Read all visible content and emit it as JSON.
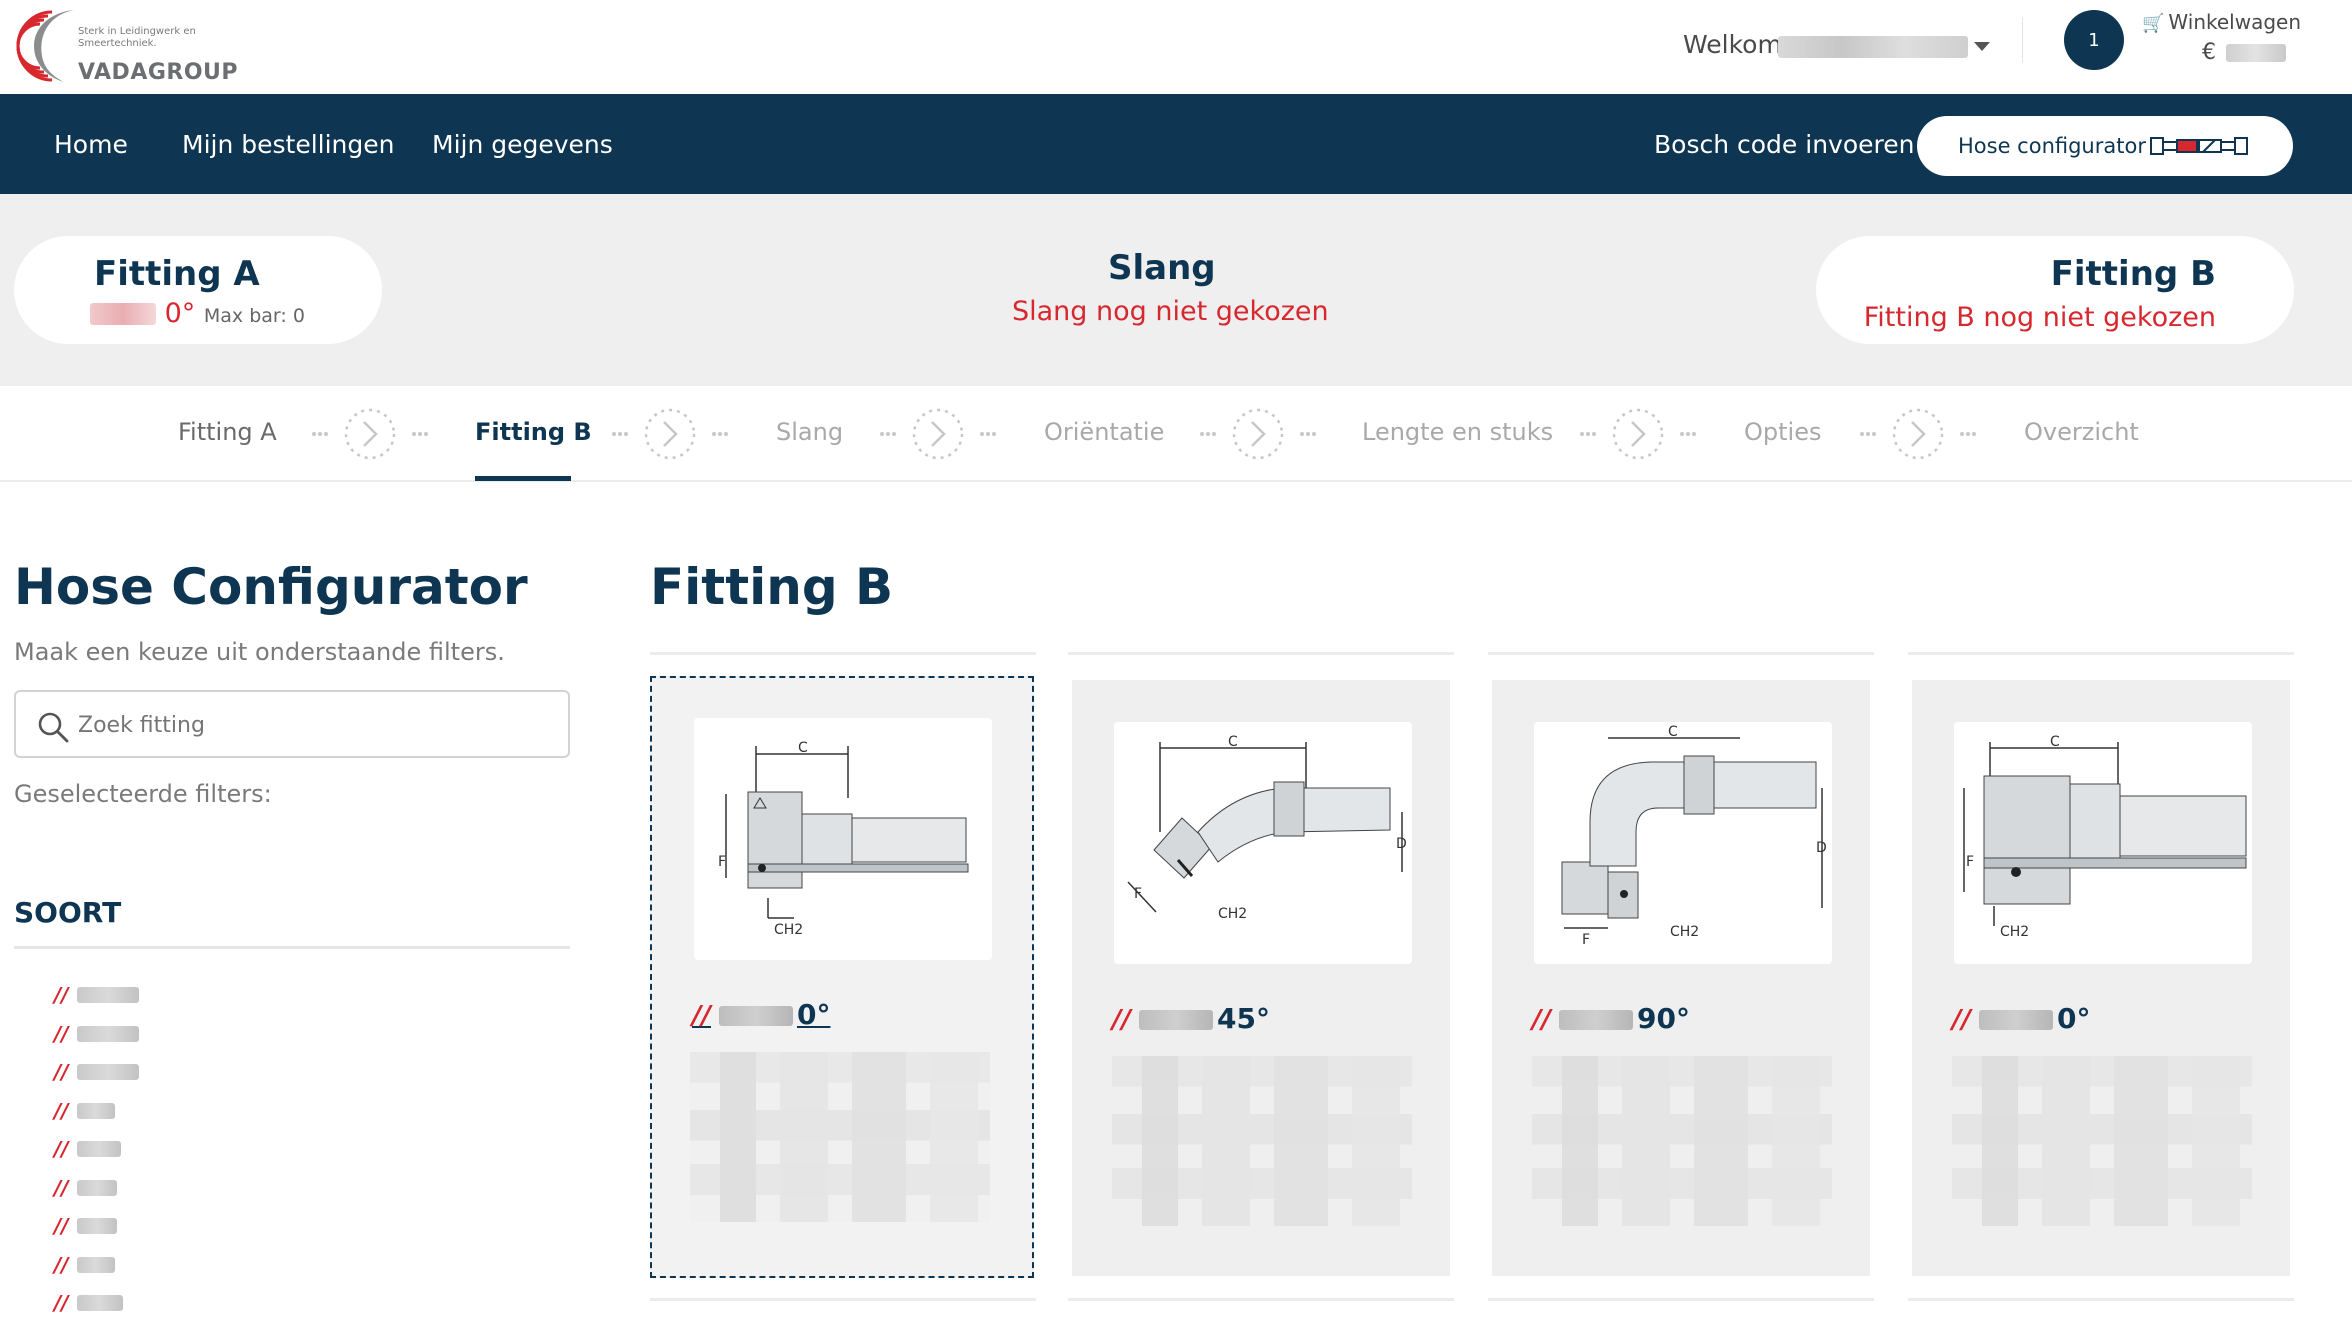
{
  "header": {
    "logo": {
      "tagline": "Sterk in Leidingwerk en Smeertechniek.",
      "name": "VADAGROUP"
    },
    "welcome_label": "Welkom",
    "cart": {
      "badge_count": "1",
      "label": "Winkelwagen",
      "currency": "€"
    }
  },
  "nav": {
    "items": [
      {
        "label": "Home"
      },
      {
        "label": "Mijn bestellingen"
      },
      {
        "label": "Mijn gegevens"
      }
    ],
    "bosch_code": "Bosch code invoeren",
    "hose_configurator": "Hose configurator"
  },
  "summary": {
    "fitting_a": {
      "title": "Fitting A",
      "angle": "0°",
      "maxbar": "Max bar: 0"
    },
    "slang": {
      "title": "Slang",
      "status": "Slang nog niet gekozen"
    },
    "fitting_b": {
      "title": "Fitting B",
      "status": "Fitting B nog niet gekozen"
    }
  },
  "steps": [
    {
      "label": "Fitting A",
      "state": "done"
    },
    {
      "label": "Fitting B",
      "state": "active"
    },
    {
      "label": "Slang",
      "state": "todo"
    },
    {
      "label": "Oriëntatie",
      "state": "todo"
    },
    {
      "label": "Lengte en stuks",
      "state": "todo"
    },
    {
      "label": "Opties",
      "state": "todo"
    },
    {
      "label": "Overzicht",
      "state": "todo"
    }
  ],
  "sidebar": {
    "title": "Hose Configurator",
    "subtitle": "Maak een keuze uit onderstaande filters.",
    "search_placeholder": "Zoek fitting",
    "selected_filters_label": "Geselecteerde filters:",
    "soort_heading": "SOORT",
    "soort_slash": "//"
  },
  "main": {
    "title": "Fitting B",
    "cards": [
      {
        "slash": "//",
        "angle": "0°",
        "selected": true
      },
      {
        "slash": "//",
        "angle": "45°",
        "selected": false
      },
      {
        "slash": "//",
        "angle": "90°",
        "selected": false
      },
      {
        "slash": "//",
        "angle": "0°",
        "selected": false
      }
    ]
  },
  "colors": {
    "navy": "#0e3551",
    "red": "#d7282f",
    "band": "#efefef"
  }
}
